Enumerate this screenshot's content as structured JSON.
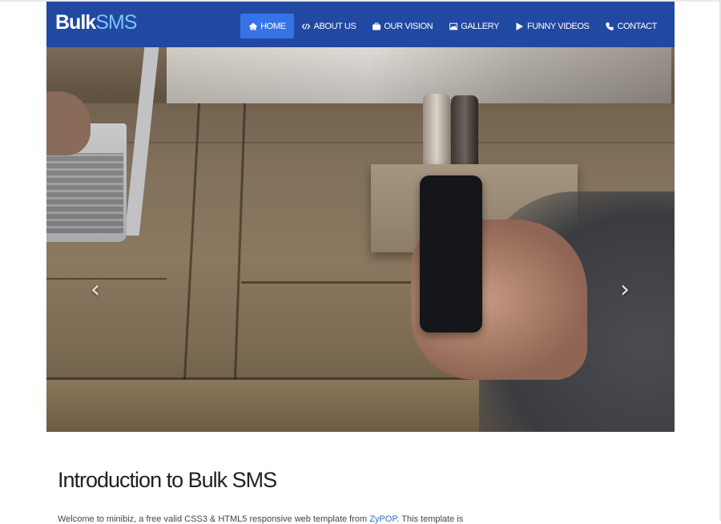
{
  "brand": {
    "part1": "Bulk",
    "part2": "SMS"
  },
  "nav": [
    {
      "label": "HOME",
      "icon": "home-icon",
      "active": true
    },
    {
      "label": "ABOUT US",
      "icon": "code-icon",
      "active": false
    },
    {
      "label": "OUR VISION",
      "icon": "briefcase-icon",
      "active": false
    },
    {
      "label": "GALLERY",
      "icon": "picture-icon",
      "active": false
    },
    {
      "label": "FUNNY VIDEOS",
      "icon": "play-icon",
      "active": false
    },
    {
      "label": "CONTACT",
      "icon": "phone-icon",
      "active": false
    }
  ],
  "carousel": {
    "prev": "‹",
    "next": "›"
  },
  "intro": {
    "title": "Introduction to Bulk SMS",
    "text_before": "Welcome to minibiz, a free valid CSS3 & HTML5 responsive web template from ",
    "link": "ZyPOP",
    "text_after": ". This template is"
  },
  "colors": {
    "navbar": "#2249a1",
    "active": "#3673e6",
    "brand_accent": "#7fc2ff"
  }
}
